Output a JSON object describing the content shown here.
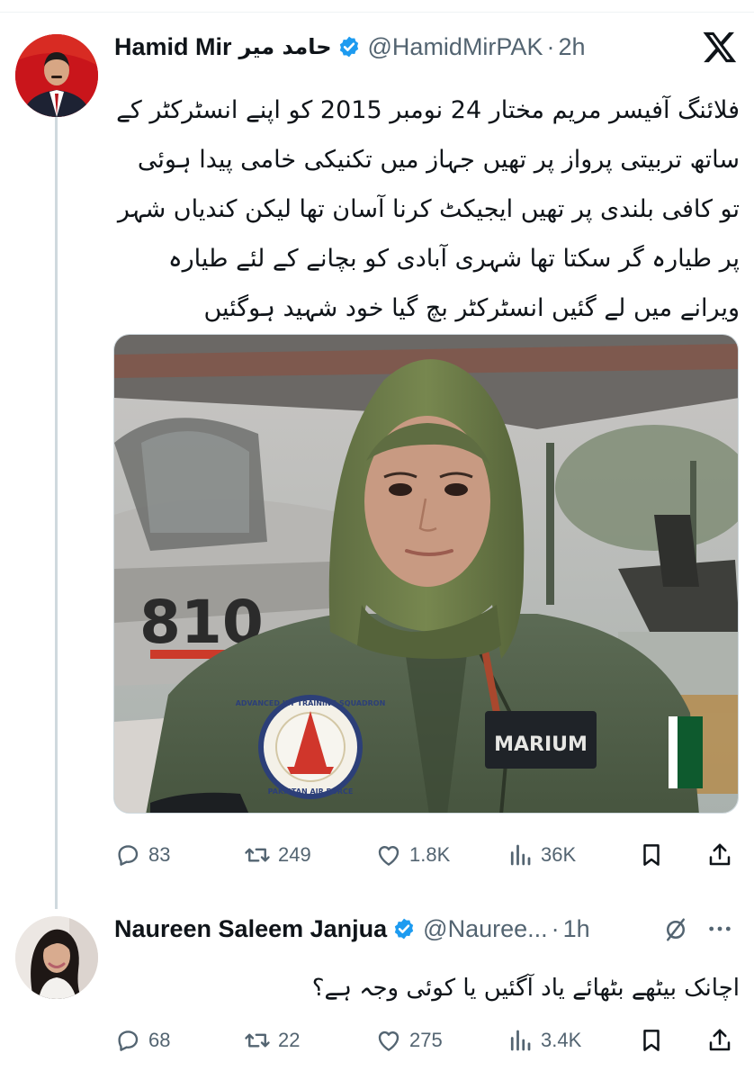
{
  "tweet": {
    "author_name": "Hamid Mir",
    "author_name_urdu": "حامد میر",
    "handle": "@HamidMirPAK",
    "separator": "·",
    "time": "2h",
    "text": "فلائنگ آفیسر مریم مختار 24 نومبر 2015 کو اپنے انسٹرکٹر کے ساتھ تربیتی پرواز پر تھیں جہاز میں تکنیکی خامی پیدا ہوئی تو کافی بلندی پر تھیں ایجیکٹ کرنا آسان تھا لیکن کندیاں شہر پر طیارہ گر سکتا تھا شہری آبادی کو بچانے کے لئے طیارہ ویرانے میں لے گئیں انسٹرکٹر بچ گیا خود شہید ہوگئیں",
    "image": {
      "aircraft_number": "810",
      "name_patch": "MARIUM",
      "badge_top_text": "ADVANCED JET TRAINING SQUADRON",
      "badge_bottom_text": "PAKISTAN AIR FORCE"
    },
    "stats": {
      "replies": "83",
      "reposts": "249",
      "likes": "1.8K",
      "views": "36K"
    }
  },
  "reply": {
    "author_name": "Naureen Saleem Janjua",
    "handle": "@Nauree...",
    "separator": "·",
    "time": "1h",
    "text": "اچانک بیٹھے بٹھائے یاد آگئیں یا کوئی وجہ ہے؟",
    "stats": {
      "replies": "68",
      "reposts": "22",
      "likes": "275",
      "views": "3.4K"
    }
  },
  "colors": {
    "text": "#0f1419",
    "secondary": "#536471",
    "verified": "#1d9bf0",
    "thread_line": "#cfd9de"
  },
  "icons": [
    "x-logo-icon",
    "verified-icon",
    "reply-icon",
    "repost-icon",
    "like-icon",
    "views-icon",
    "bookmark-icon",
    "share-icon",
    "mute-icon",
    "more-icon"
  ]
}
